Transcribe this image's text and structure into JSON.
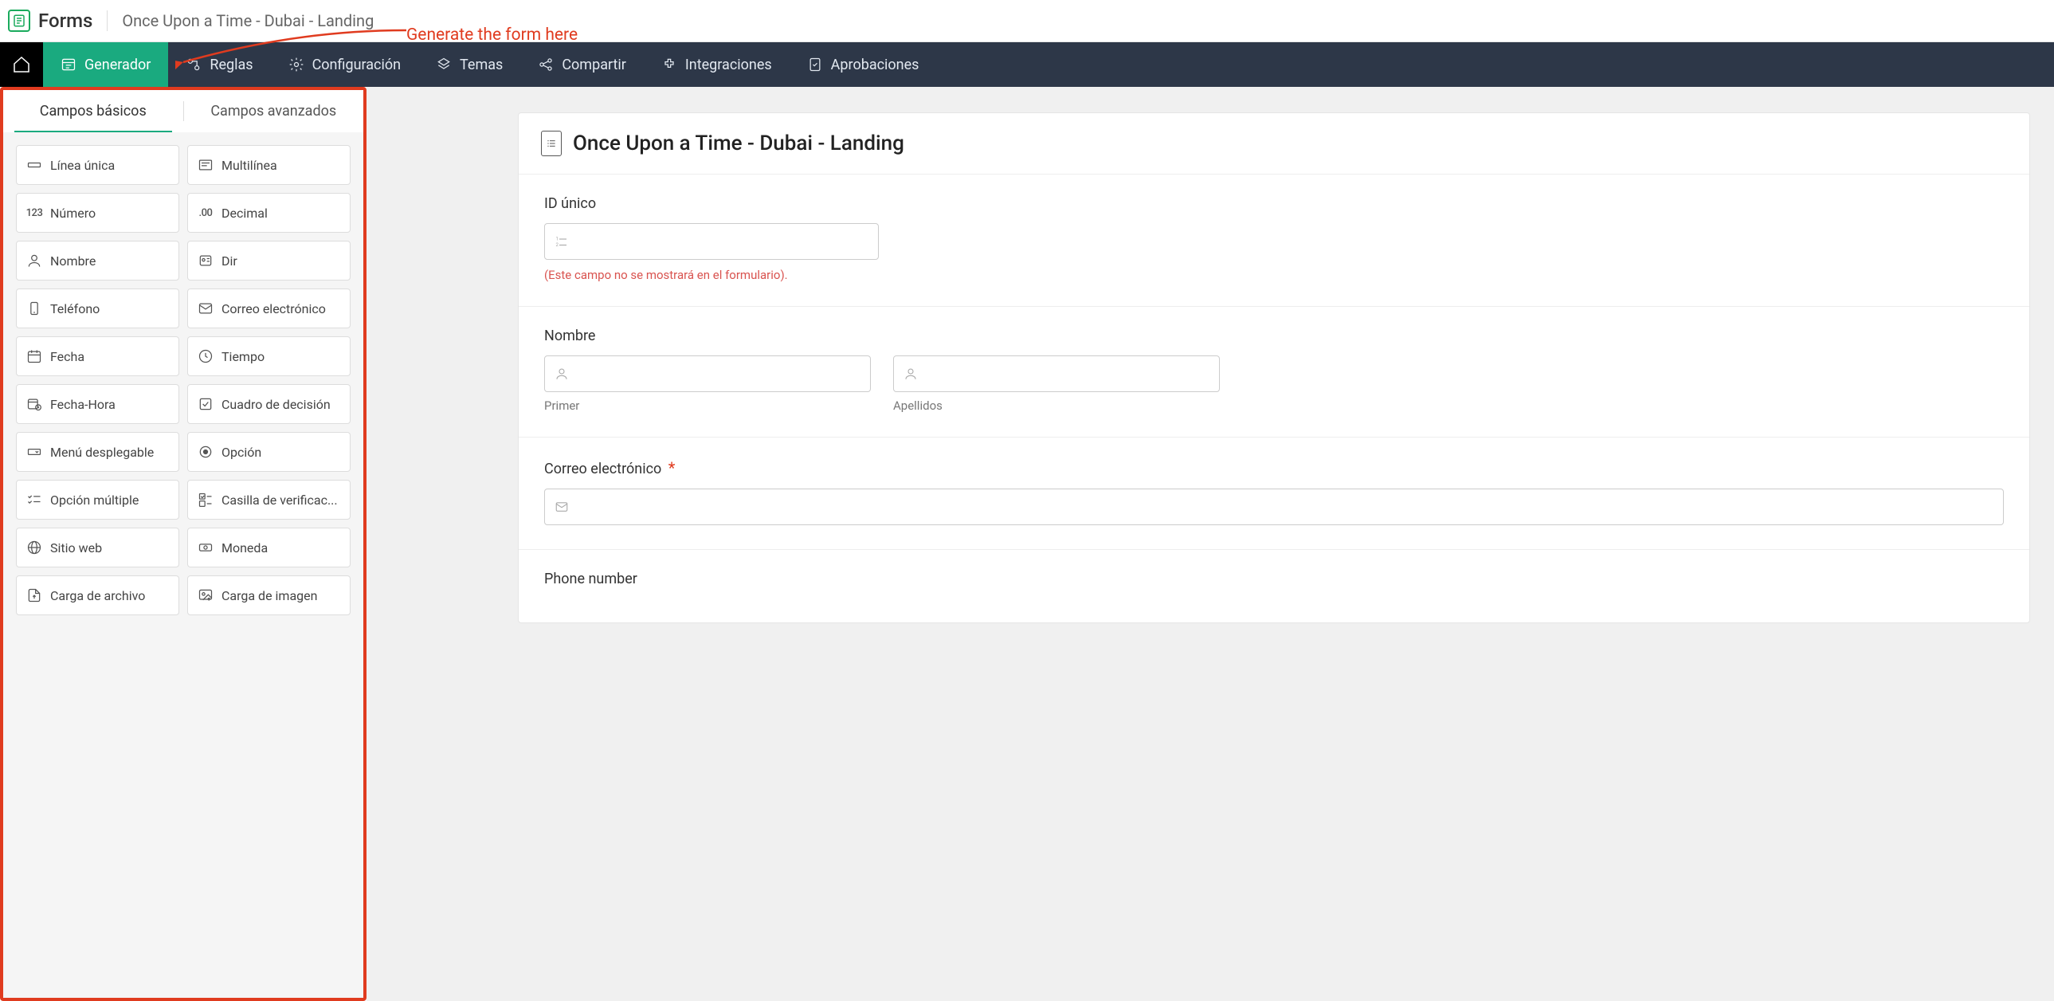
{
  "header": {
    "app_name": "Forms",
    "form_title": "Once Upon a Time - Dubai - Landing"
  },
  "annotation": {
    "text": "Generate the form here"
  },
  "nav": {
    "items": [
      {
        "label": "Generador",
        "active": true,
        "icon": "builder"
      },
      {
        "label": "Reglas",
        "active": false,
        "icon": "rules"
      },
      {
        "label": "Configuración",
        "active": false,
        "icon": "settings"
      },
      {
        "label": "Temas",
        "active": false,
        "icon": "themes"
      },
      {
        "label": "Compartir",
        "active": false,
        "icon": "share"
      },
      {
        "label": "Integraciones",
        "active": false,
        "icon": "integrations"
      },
      {
        "label": "Aprobaciones",
        "active": false,
        "icon": "approvals"
      }
    ]
  },
  "sidebar": {
    "tabs": {
      "basic": "Campos básicos",
      "advanced": "Campos avanzados"
    },
    "fields": [
      {
        "label": "Línea única",
        "icon": "single-line"
      },
      {
        "label": "Multilínea",
        "icon": "multi-line"
      },
      {
        "label": "Número",
        "icon": "number-123"
      },
      {
        "label": "Decimal",
        "icon": "decimal"
      },
      {
        "label": "Nombre",
        "icon": "person"
      },
      {
        "label": "Dir",
        "icon": "address"
      },
      {
        "label": "Teléfono",
        "icon": "phone"
      },
      {
        "label": "Correo electrónico",
        "icon": "mail"
      },
      {
        "label": "Fecha",
        "icon": "date"
      },
      {
        "label": "Tiempo",
        "icon": "clock"
      },
      {
        "label": "Fecha-Hora",
        "icon": "datetime"
      },
      {
        "label": "Cuadro de decisión",
        "icon": "decision"
      },
      {
        "label": "Menú desplegable",
        "icon": "dropdown"
      },
      {
        "label": "Opción",
        "icon": "radio"
      },
      {
        "label": "Opción múltiple",
        "icon": "multi-select"
      },
      {
        "label": "Casilla de verificac...",
        "icon": "checkbox"
      },
      {
        "label": "Sitio web",
        "icon": "web"
      },
      {
        "label": "Moneda",
        "icon": "currency"
      },
      {
        "label": "Carga de archivo",
        "icon": "file-upload"
      },
      {
        "label": "Carga de imagen",
        "icon": "image-upload"
      }
    ]
  },
  "form": {
    "title": "Once Upon a Time - Dubai - Landing",
    "sections": {
      "unique_id": {
        "label": "ID único",
        "note": "(Este campo no se mostrará en el formulario)."
      },
      "name": {
        "label": "Nombre",
        "first_sub": "Primer",
        "last_sub": "Apellidos"
      },
      "email": {
        "label": "Correo electrónico",
        "required": true
      },
      "phone": {
        "label": "Phone number"
      }
    }
  }
}
